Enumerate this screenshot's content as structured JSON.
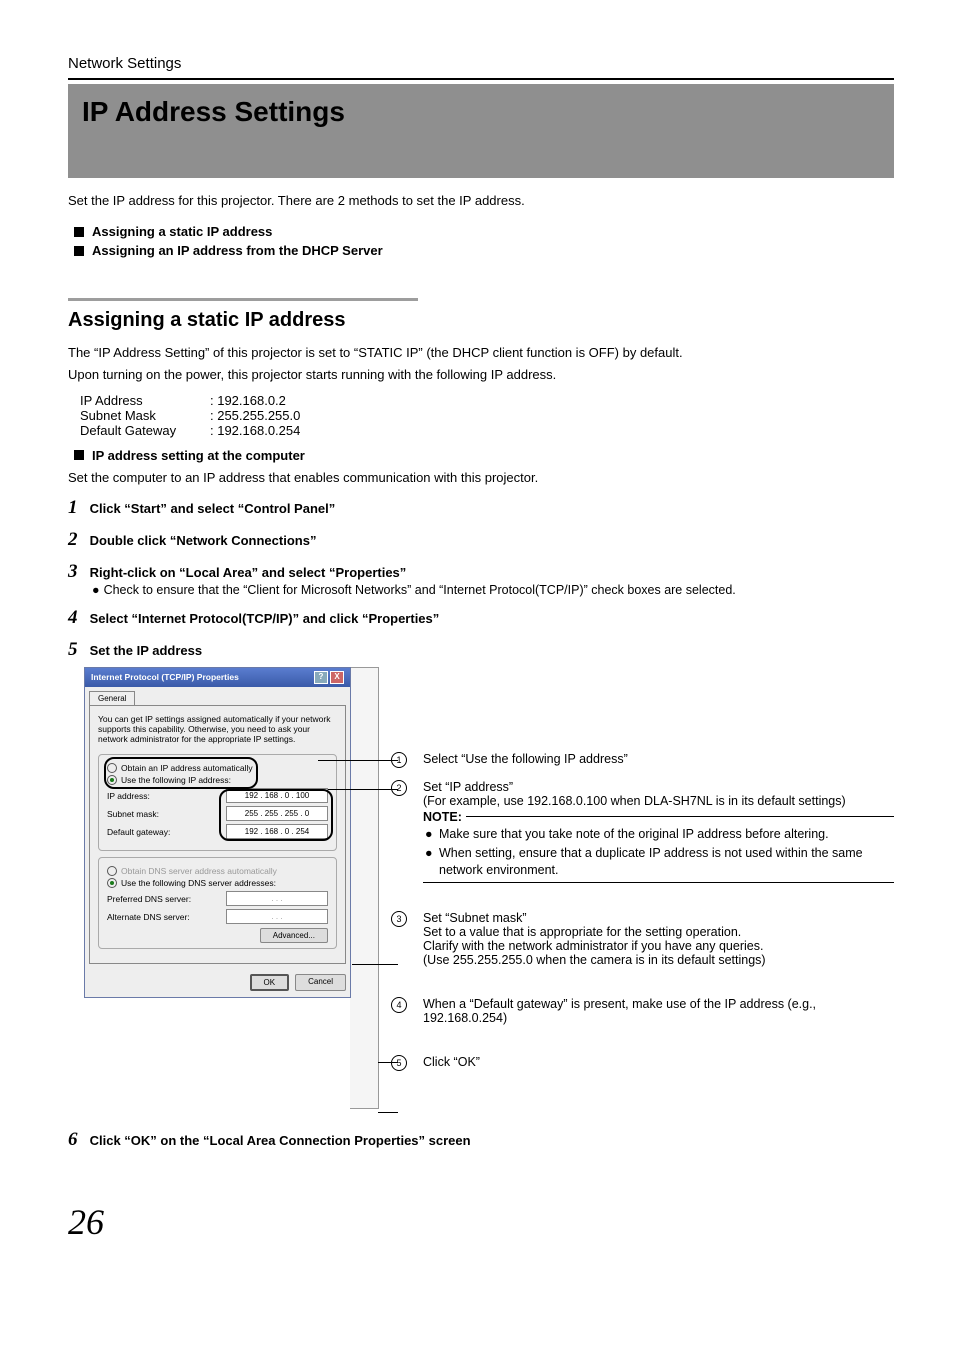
{
  "breadcrumb": "Network Settings",
  "title": "IP Address Settings",
  "intro": "Set the IP address for this projector. There are 2 methods to set the IP address.",
  "top_bullets": [
    "Assigning a static IP address",
    "Assigning an IP address from the DHCP Server"
  ],
  "section_heading": "Assigning a static IP address",
  "section_p1": "The “IP Address Setting” of this projector is set to “STATIC IP” (the DHCP client function is OFF) by default.",
  "section_p2": "Upon turning on the power, this projector starts running with the following IP address.",
  "defaults": {
    "ip_label": "IP Address",
    "ip_val": ": 192.168.0.2",
    "mask_label": "Subnet Mask",
    "mask_val": ": 255.255.255.0",
    "gw_label": "Default Gateway",
    "gw_val": ": 192.168.0.254"
  },
  "sub_head": "IP address setting at the computer",
  "sub_desc": "Set the computer to an IP address that enables communication with this projector.",
  "steps": {
    "s1_num": "1",
    "s1": "Click “Start” and select “Control Panel”",
    "s2_num": "2",
    "s2": "Double click “Network Connections”",
    "s3_num": "3",
    "s3": "Right-click on “Local Area” and select “Properties”",
    "s3_sub_bullet": "●",
    "s3_sub": "Check to ensure that the “Client for Microsoft Networks” and “Internet Protocol(TCP/IP)” check boxes are selected.",
    "s4_num": "4",
    "s4": "Select “Internet Protocol(TCP/IP)” and click “Properties”",
    "s5_num": "5",
    "s5": "Set the IP address",
    "s6_num": "6",
    "s6": "Click “OK” on the “Local Area Connection Properties” screen"
  },
  "dialog": {
    "title": "Internet Protocol (TCP/IP) Properties",
    "tab": "General",
    "desc": "You can get IP settings assigned automatically if your network supports this capability. Otherwise, you need to ask your network administrator for the appropriate IP settings.",
    "radio_auto": "Obtain an IP address automatically",
    "radio_use": "Use the following IP address:",
    "ip_label": "IP address:",
    "ip_val": "192 . 168 .   0 . 100",
    "mask_label": "Subnet mask:",
    "mask_val": "255 . 255 . 255 .   0",
    "gw_label": "Default gateway:",
    "gw_val": "192 . 168 .   0 . 254",
    "radio_dns_auto": "Obtain DNS server address automatically",
    "radio_dns_use": "Use the following DNS server addresses:",
    "pref_dns": "Preferred DNS server:",
    "alt_dns": "Alternate DNS server:",
    "dns_empty": ".       .       .",
    "advanced": "Advanced...",
    "ok": "OK",
    "cancel": "Cancel"
  },
  "callouts": {
    "c1_num": "1",
    "c1": "Select “Use the following IP address”",
    "c2_num": "2",
    "c2_a": "Set “IP address”",
    "c2_b": "(For example, use 192.168.0.100 when DLA-SH7NL is in its default settings)",
    "note_label": "NOTE:",
    "note1": "Make sure that you take note of the original IP address before altering.",
    "note2": "When setting, ensure that a duplicate IP address is not used within the same network environment.",
    "c3_num": "3",
    "c3_a": "Set “Subnet mask”",
    "c3_b": "Set to a value that is appropriate for the setting operation.",
    "c3_c": "Clarify with the network administrator if you have any queries.",
    "c3_d": "(Use 255.255.255.0 when the camera is in its default settings)",
    "c4_num": "4",
    "c4": "When a “Default gateway” is present, make use of the IP address (e.g., 192.168.0.254)",
    "c5_num": "5",
    "c5": "Click “OK”"
  },
  "page_number": "26"
}
